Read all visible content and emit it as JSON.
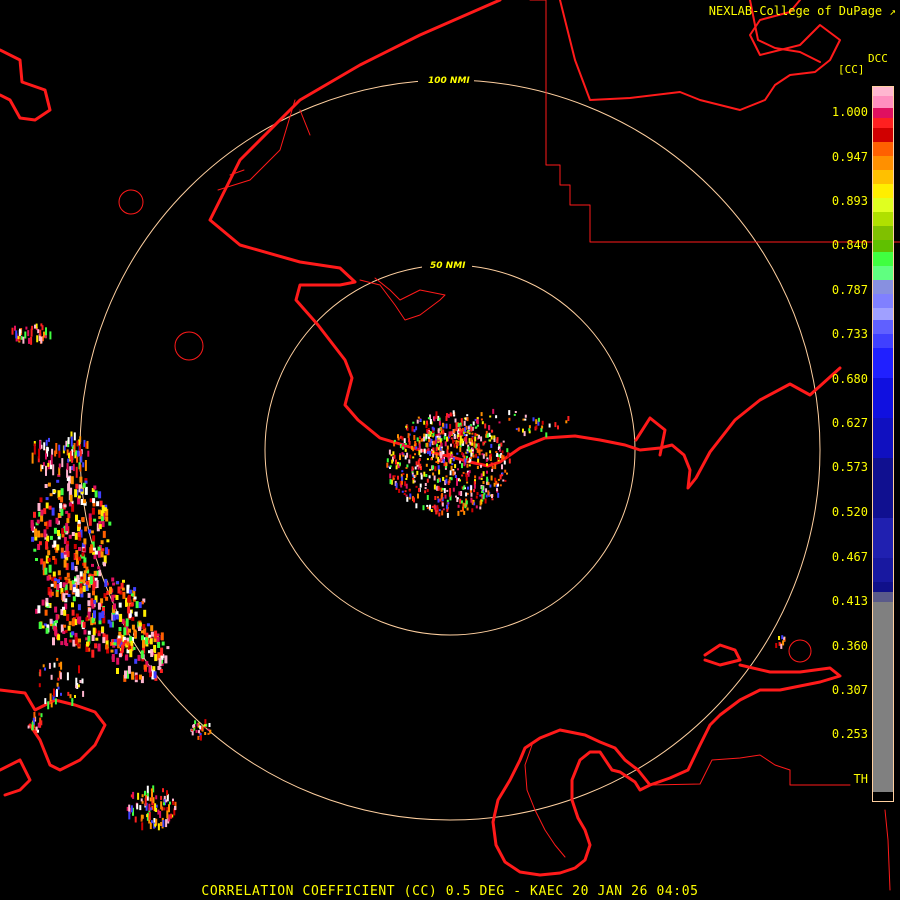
{
  "credit": "NEXLAB-College of DuPage",
  "scale": {
    "title": "DCC",
    "unit": "[CC]",
    "labels": [
      "1.000",
      "0.947",
      "0.893",
      "0.840",
      "0.787",
      "0.733",
      "0.680",
      "0.627",
      "0.573",
      "0.520",
      "0.467",
      "0.413",
      "0.360",
      "0.307",
      "0.253",
      "TH"
    ]
  },
  "range_rings": [
    "100 NMI",
    "50 NMI"
  ],
  "footer": "CORRELATION COEFFICIENT (CC) 0.5 DEG - KAEC 20 JAN 26 04:05",
  "colors": {
    "background": "#000000",
    "text": "#ffff00",
    "coastline": "#ff1a1a",
    "ring": "#ffd0a0"
  }
}
